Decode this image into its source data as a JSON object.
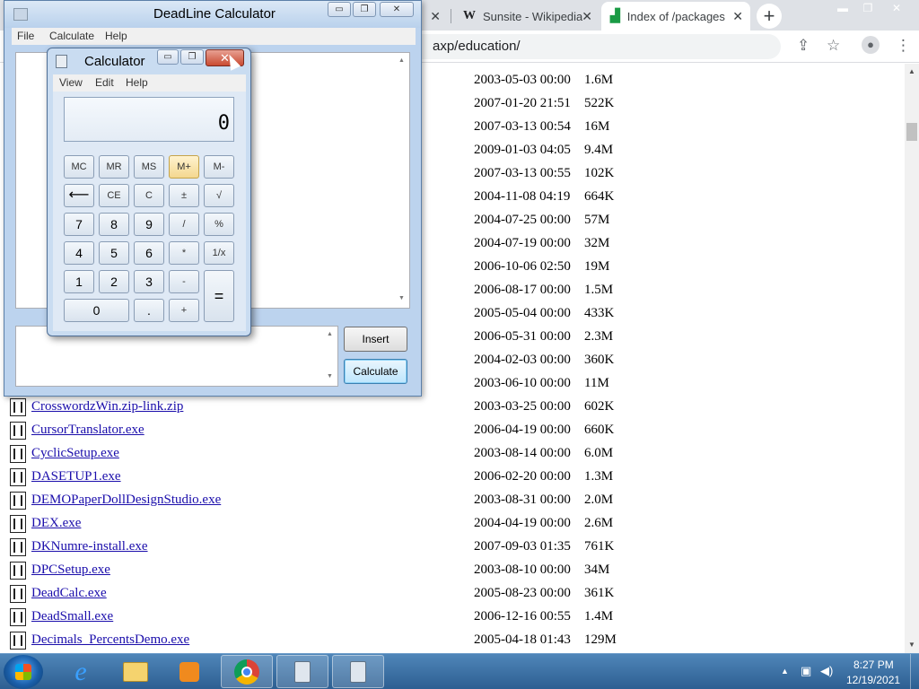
{
  "browser": {
    "tabs": [
      {
        "label": "",
        "favicon": ""
      },
      {
        "label": "Sunsite - Wikipedia",
        "favicon": "W"
      },
      {
        "label": "Index of /packages",
        "favicon": "folder"
      }
    ],
    "address": "axp/education/",
    "files": [
      {
        "name": "",
        "date": "2003-05-03 00:00",
        "size": "1.6M"
      },
      {
        "name": "",
        "date": "2007-01-20 21:51",
        "size": "522K"
      },
      {
        "name": "",
        "date": "2007-03-13 00:54",
        "size": "16M"
      },
      {
        "name": "",
        "date": "2009-01-03 04:05",
        "size": "9.4M"
      },
      {
        "name": "",
        "date": "2007-03-13 00:55",
        "size": "102K"
      },
      {
        "name": "",
        "date": "2004-11-08 04:19",
        "size": "664K"
      },
      {
        "name": "",
        "date": "2004-07-25 00:00",
        "size": "57M"
      },
      {
        "name": "",
        "date": "2004-07-19 00:00",
        "size": "32M"
      },
      {
        "name": "",
        "date": "2006-10-06 02:50",
        "size": "19M"
      },
      {
        "name": "",
        "date": "2006-08-17 00:00",
        "size": "1.5M"
      },
      {
        "name": "",
        "date": "2005-05-04 00:00",
        "size": "433K"
      },
      {
        "name": "",
        "date": "2006-05-31 00:00",
        "size": "2.3M"
      },
      {
        "name": "",
        "date": "2004-02-03 00:00",
        "size": "360K"
      },
      {
        "name": "",
        "date": "2003-06-10 00:00",
        "size": "11M"
      },
      {
        "name": "CrosswordzWin.zip-link.zip",
        "date": "2003-03-25 00:00",
        "size": "602K"
      },
      {
        "name": "CursorTranslator.exe",
        "date": "2006-04-19 00:00",
        "size": "660K"
      },
      {
        "name": "CyclicSetup.exe",
        "date": "2003-08-14 00:00",
        "size": "6.0M"
      },
      {
        "name": "DASETUP1.exe",
        "date": "2006-02-20 00:00",
        "size": "1.3M"
      },
      {
        "name": "DEMOPaperDollDesignStudio.exe",
        "date": "2003-08-31 00:00",
        "size": "2.0M"
      },
      {
        "name": "DEX.exe",
        "date": "2004-04-19 00:00",
        "size": "2.6M"
      },
      {
        "name": "DKNumre-install.exe",
        "date": "2007-09-03 01:35",
        "size": "761K"
      },
      {
        "name": "DPCSetup.exe",
        "date": "2003-08-10 00:00",
        "size": "34M"
      },
      {
        "name": "DeadCalc.exe",
        "date": "2005-08-23 00:00",
        "size": "361K"
      },
      {
        "name": "DeadSmall.exe",
        "date": "2006-12-16 00:55",
        "size": "1.4M"
      },
      {
        "name": "Decimals_PercentsDemo.exe",
        "date": "2005-04-18 01:43",
        "size": "129M"
      }
    ]
  },
  "deadline": {
    "title": "DeadLine Calculator",
    "menu": [
      "File",
      "Calculate",
      "Help"
    ],
    "insert_label": "Insert",
    "calculate_label": "Calculate"
  },
  "calculator": {
    "title": "Calculator",
    "menu": [
      "View",
      "Edit",
      "Help"
    ],
    "display": "0",
    "keys": {
      "mc": "MC",
      "mr": "MR",
      "ms": "MS",
      "mplus": "M+",
      "mminus": "M-",
      "back": "⟵",
      "ce": "CE",
      "c": "C",
      "plusminus": "±",
      "sqrt": "√",
      "k7": "7",
      "k8": "8",
      "k9": "9",
      "div": "/",
      "pct": "%",
      "k4": "4",
      "k5": "5",
      "k6": "6",
      "mul": "*",
      "recip": "1/x",
      "k1": "1",
      "k2": "2",
      "k3": "3",
      "sub": "-",
      "eq": "=",
      "k0": "0",
      "dot": ".",
      "add": "+"
    }
  },
  "taskbar": {
    "time": "8:27 PM",
    "date": "12/19/2021"
  },
  "colors": {
    "link": "#1a0dab",
    "taskbar": "#2d5f92",
    "highlight_key": "#f4d78f"
  }
}
